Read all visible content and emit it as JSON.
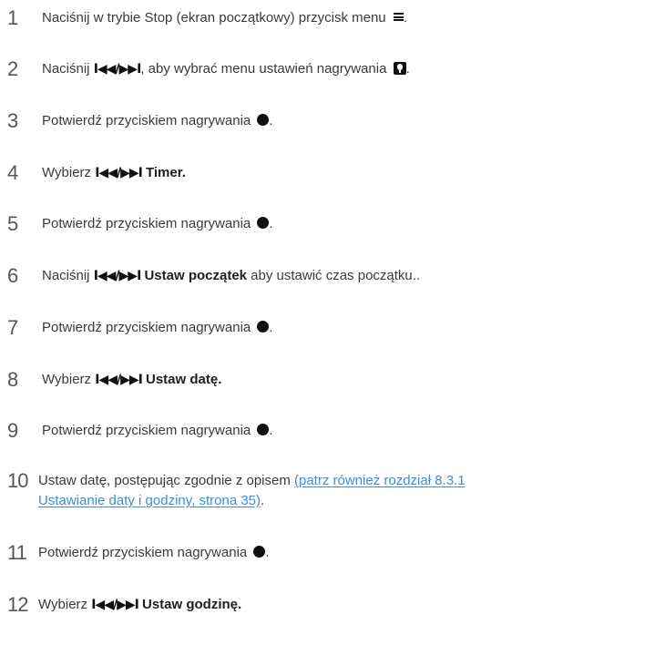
{
  "steps": [
    {
      "number": "1",
      "text_before": "Naciśnij w trybie Stop (ekran początkowy) przycisk menu",
      "icon": "menu-icon",
      "text_after": "."
    },
    {
      "number": "2",
      "text_before": "Naciśnij",
      "nav_symbol": "I◀◀/▶▶I",
      "text_middle": ", aby wybrać menu ustawień nagrywania",
      "icon": "microphone-settings-icon",
      "text_after": "."
    },
    {
      "number": "3",
      "text_before": "Potwierdź przyciskiem nagrywania",
      "icon": "record-dot-icon",
      "text_after": "."
    },
    {
      "number": "4",
      "text_before": "Wybierz",
      "nav_symbol": "I◀◀/▶▶I",
      "bold_text": "Timer",
      "text_after": "."
    },
    {
      "number": "5",
      "text_before": "Potwierdź przyciskiem nagrywania",
      "icon": "record-dot-icon",
      "text_after": "."
    },
    {
      "number": "6",
      "text_before": "Naciśnij",
      "nav_symbol": "I◀◀/▶▶I",
      "bold_text": "Ustaw początek",
      "text_after": " aby ustawić czas początku.."
    },
    {
      "number": "7",
      "text_before": "Potwierdź przyciskiem nagrywania",
      "icon": "record-dot-icon",
      "text_after": "."
    },
    {
      "number": "8",
      "text_before": "Wybierz",
      "nav_symbol": "I◀◀/▶▶I",
      "bold_text": "Ustaw datę",
      "text_after": "."
    },
    {
      "number": "9",
      "text_before": "Potwierdź przyciskiem nagrywania",
      "icon": "record-dot-icon",
      "text_after": "."
    },
    {
      "number": "10",
      "text_before": "Ustaw datę, postępując zgodnie z opisem",
      "link_line1": "(patrz również rozdział 8.3.1",
      "link_line2": "Ustawianie daty i godziny, strona 35)",
      "text_after": "."
    },
    {
      "number": "11",
      "text_before": "Potwierdź przyciskiem nagrywania",
      "icon": "record-dot-icon",
      "text_after": "."
    },
    {
      "number": "12",
      "text_before": "Wybierz",
      "nav_symbol": "I◀◀/▶▶I",
      "bold_text": "Ustaw godzinę",
      "text_after": "."
    }
  ],
  "colors": {
    "text": "#3a3a3a",
    "number": "#555555",
    "link": "#3a8fd6",
    "icon": "#111111"
  }
}
